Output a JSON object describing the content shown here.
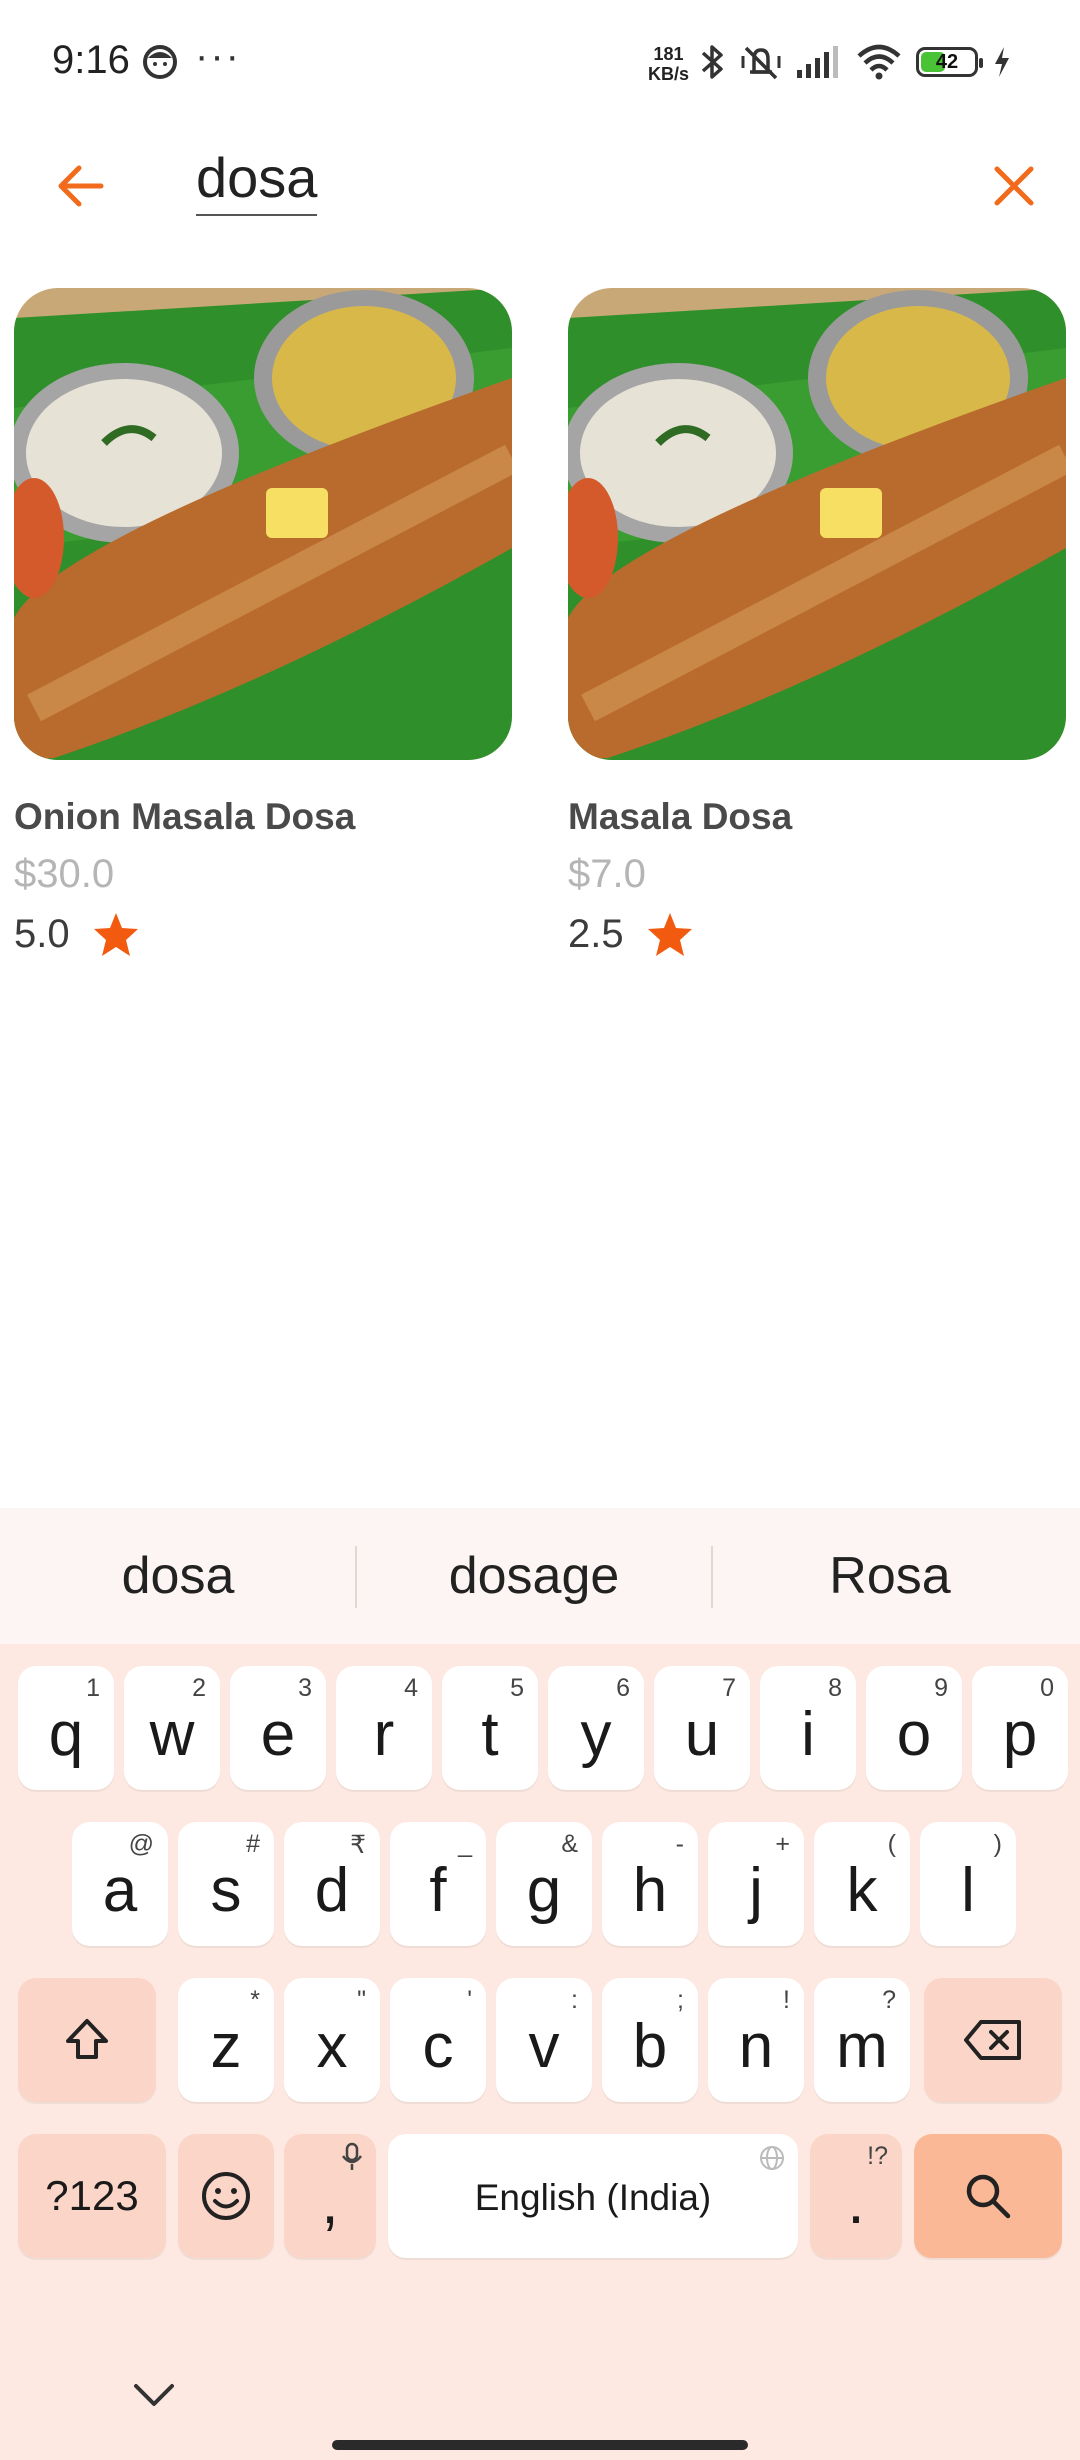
{
  "status_bar": {
    "time": "9:16",
    "more": "···",
    "net_speed_value": "181",
    "net_speed_unit": "KB/s",
    "battery_level": "42",
    "icons": [
      "face-icon",
      "bluetooth-icon",
      "mute-vibrate-icon",
      "signal-icon",
      "wifi-icon",
      "battery-icon",
      "charging-icon"
    ]
  },
  "search": {
    "query": "dosa",
    "back_icon": "arrow-left-icon",
    "clear_icon": "close-icon",
    "accent_color": "#f26a1b"
  },
  "results": [
    {
      "name": "Onion Masala Dosa",
      "price": "$30.0",
      "rating": "5.0"
    },
    {
      "name": "Masala Dosa",
      "price": "$7.0",
      "rating": "2.5"
    }
  ],
  "keyboard": {
    "suggestions": [
      "dosa",
      "dosage",
      "Rosa"
    ],
    "row1": [
      {
        "k": "q",
        "h": "1"
      },
      {
        "k": "w",
        "h": "2"
      },
      {
        "k": "e",
        "h": "3"
      },
      {
        "k": "r",
        "h": "4"
      },
      {
        "k": "t",
        "h": "5"
      },
      {
        "k": "y",
        "h": "6"
      },
      {
        "k": "u",
        "h": "7"
      },
      {
        "k": "i",
        "h": "8"
      },
      {
        "k": "o",
        "h": "9"
      },
      {
        "k": "p",
        "h": "0"
      }
    ],
    "row2": [
      {
        "k": "a",
        "h": "@"
      },
      {
        "k": "s",
        "h": "#"
      },
      {
        "k": "d",
        "h": "₹"
      },
      {
        "k": "f",
        "h": "_"
      },
      {
        "k": "g",
        "h": "&"
      },
      {
        "k": "h",
        "h": "-"
      },
      {
        "k": "j",
        "h": "+"
      },
      {
        "k": "k",
        "h": "("
      },
      {
        "k": "l",
        "h": ")"
      }
    ],
    "row3": [
      {
        "k": "z",
        "h": "*"
      },
      {
        "k": "x",
        "h": "\""
      },
      {
        "k": "c",
        "h": "'"
      },
      {
        "k": "v",
        "h": ":"
      },
      {
        "k": "b",
        "h": ";"
      },
      {
        "k": "n",
        "h": "!"
      },
      {
        "k": "m",
        "h": "?"
      }
    ],
    "symbols_label": "?123",
    "comma_label": ",",
    "space_label": "English (India)",
    "period_label": ".",
    "period_hint": "!?",
    "key_color": "#ffffff",
    "func_key_color": "#fbd5c7",
    "action_key_color": "#fbb896"
  }
}
